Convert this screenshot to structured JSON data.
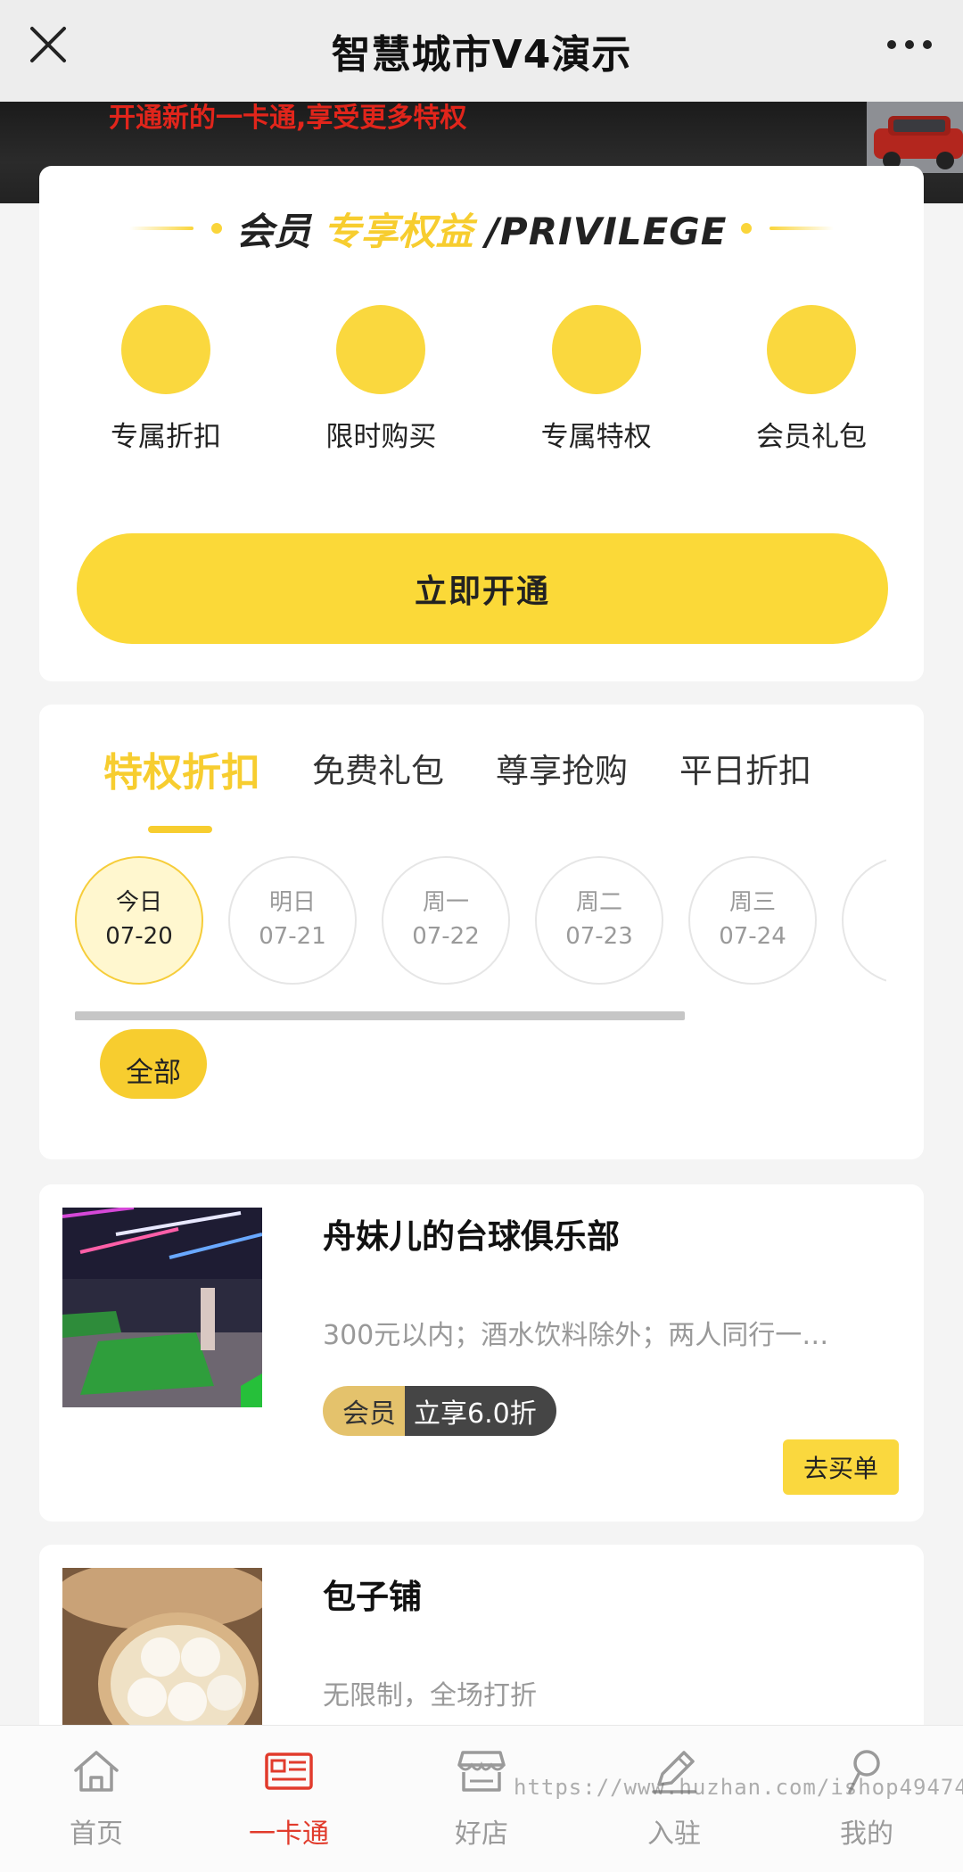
{
  "navbar": {
    "title": "智慧城市V4演示"
  },
  "banner": {
    "text": "开通新的一卡通,享受更多特权"
  },
  "privilege": {
    "title_part1": "会员",
    "title_part2": "专享权益",
    "title_part3": "/PRIVILEGE",
    "benefits": [
      {
        "label": "专属折扣"
      },
      {
        "label": "限时购买"
      },
      {
        "label": "专属特权"
      },
      {
        "label": "会员礼包"
      }
    ],
    "open_button": "立即开通",
    "accent_color": "#fad83e"
  },
  "tabs": [
    {
      "label": "特权折扣"
    },
    {
      "label": "免费礼包"
    },
    {
      "label": "尊享抢购"
    },
    {
      "label": "平日折扣"
    }
  ],
  "dates": [
    {
      "day": "今日",
      "date": "07-20"
    },
    {
      "day": "明日",
      "date": "07-21"
    },
    {
      "day": "周一",
      "date": "07-22"
    },
    {
      "day": "周二",
      "date": "07-23"
    },
    {
      "day": "周三",
      "date": "07-24"
    }
  ],
  "filter": {
    "all_label": "全部"
  },
  "shops": [
    {
      "name": "舟妹儿的台球俱乐部",
      "desc": "300元以内；酒水饮料除外；两人同行一…",
      "badge_left": "会员",
      "badge_right": "立享6.0折",
      "buy_label": "去买单"
    },
    {
      "name": "包子铺",
      "desc": "无限制，全场打折"
    }
  ],
  "tabbar": [
    {
      "label": "首页",
      "icon": "home-icon"
    },
    {
      "label": "一卡通",
      "icon": "card-icon"
    },
    {
      "label": "好店",
      "icon": "store-icon"
    },
    {
      "label": "入驻",
      "icon": "edit-icon"
    },
    {
      "label": "我的",
      "icon": "user-icon"
    }
  ],
  "watermark": "https://www.huzhan.com/ishop49474"
}
